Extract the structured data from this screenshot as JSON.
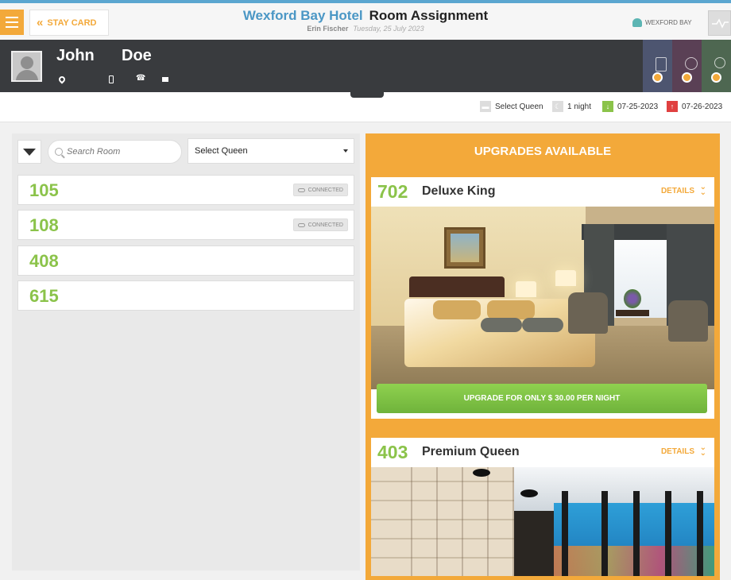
{
  "header": {
    "stay_card_label": "STAY CARD",
    "hotel_name": "Wexford Bay Hotel",
    "page_title": "Room Assignment",
    "user_name": "Erin Fischer",
    "date": "Tuesday, 25 July 2023",
    "brand_label": "WEXFORD BAY"
  },
  "guest": {
    "first_name": "John",
    "last_name": "Doe"
  },
  "stay": {
    "room_type": "Select Queen",
    "nights": "1 night",
    "arrival": "07-25-2023",
    "departure": "07-26-2023"
  },
  "filters": {
    "search_placeholder": "Search Room",
    "room_type_selected": "Select Queen"
  },
  "rooms": [
    {
      "number": "105",
      "status": "CONNECTED"
    },
    {
      "number": "108",
      "status": "CONNECTED"
    },
    {
      "number": "408",
      "status": ""
    },
    {
      "number": "615",
      "status": ""
    }
  ],
  "upgrades": {
    "title": "UPGRADES AVAILABLE",
    "details_label": "DETAILS",
    "items": [
      {
        "number": "702",
        "name": "Deluxe King",
        "button": "UPGRADE FOR ONLY $ 30.00 PER NIGHT"
      },
      {
        "number": "403",
        "name": "Premium Queen"
      }
    ]
  },
  "colors": {
    "accent": "#f3a93a",
    "brand_blue": "#4b97c5",
    "room_green": "#8bc34a",
    "guest_bar": "#393b3e"
  }
}
